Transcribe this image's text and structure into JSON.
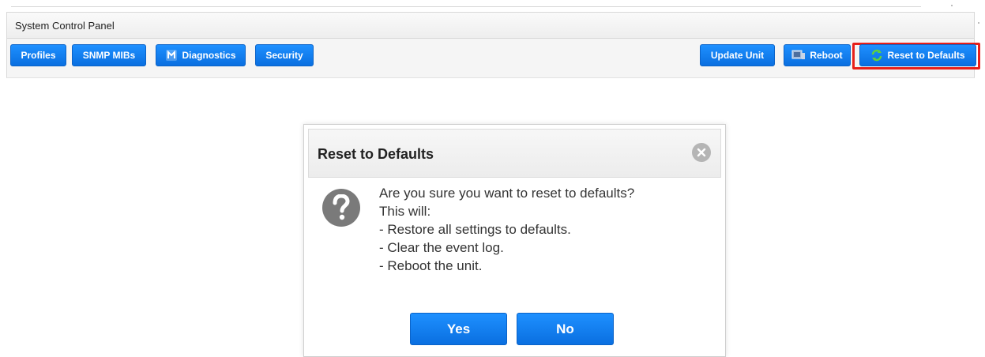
{
  "panel": {
    "title": "System Control Panel",
    "buttons": {
      "profiles": "Profiles",
      "snmp_mibs": "SNMP MIBs",
      "diagnostics": "Diagnostics",
      "security": "Security",
      "update_unit": "Update Unit",
      "reboot": "Reboot",
      "reset_to_defaults": "Reset to Defaults"
    },
    "highlighted_button": "reset_to_defaults"
  },
  "dialog": {
    "title": "Reset to Defaults",
    "message_lines": [
      "Are you sure you want to reset to defaults?",
      "This will:",
      "- Restore all settings to defaults.",
      "- Clear the event log.",
      "- Reboot the unit."
    ],
    "yes_label": "Yes",
    "no_label": "No"
  },
  "icons": {
    "diagnostics": "diagnostics-icon",
    "reboot": "reboot-icon",
    "reset": "refresh-icon",
    "close": "close-icon",
    "question": "question-icon"
  },
  "colors": {
    "button_blue": "#1e90ff",
    "highlight_red": "#e8201a",
    "reset_icon_green": "#5ed13c"
  }
}
